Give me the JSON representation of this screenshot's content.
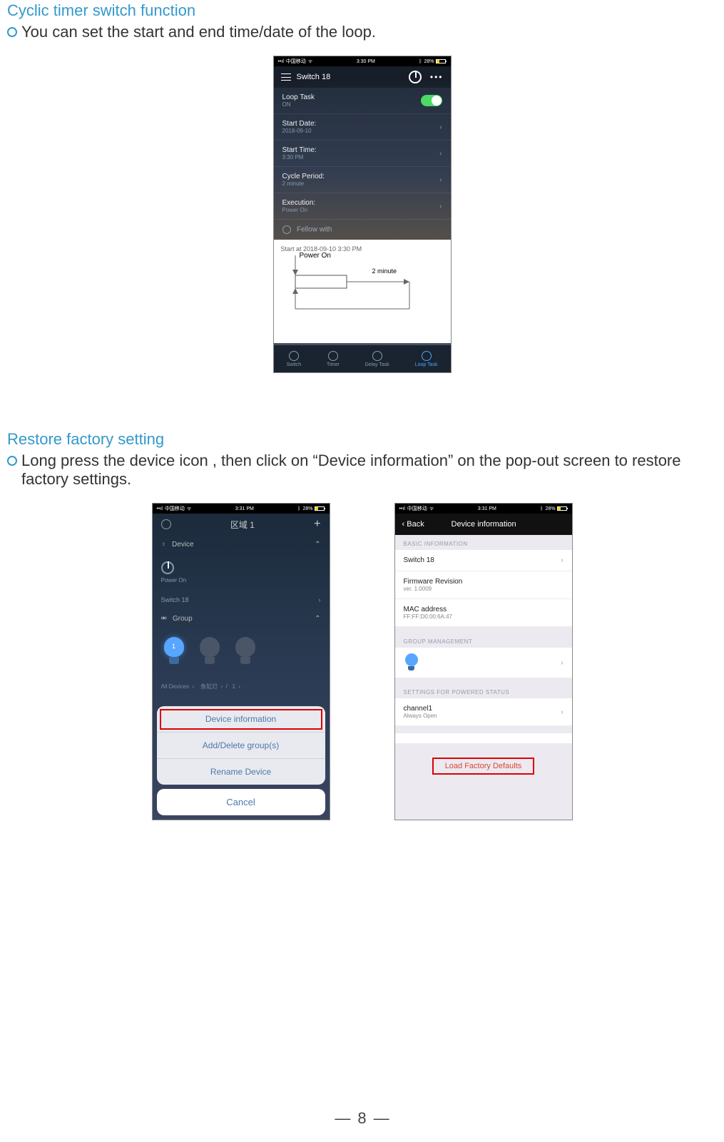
{
  "section1": {
    "heading": "Cyclic timer switch function",
    "text": "You can set the start and end time/date of the  loop."
  },
  "section2": {
    "heading": "Restore factory setting",
    "text": " Long press the device icon , then click on “Device information” on the pop-out screen to restore factory settings."
  },
  "phoneA": {
    "statusbar": {
      "carrier": "中国移动",
      "time": "3:30 PM",
      "battery": "28%"
    },
    "title": "Switch 18",
    "loopTask": {
      "label": "Loop Task",
      "state": "ON"
    },
    "startDate": {
      "label": "Start Date:",
      "value": "2018-09-10"
    },
    "startTime": {
      "label": "Start Time:",
      "value": "3:30 PM"
    },
    "cyclePeriod": {
      "label": "Cycle Period:",
      "value": "2 minute"
    },
    "execution": {
      "label": "Execution:",
      "value": "Power On"
    },
    "fellow": "Fellow with",
    "diagramStart": "Start at 2018-09-10 3:30 PM",
    "diagBox": "Power On",
    "diagPeriod": "2 minute",
    "tabs": {
      "switch": "Switch",
      "timer": "Timer",
      "delay": "Delay Task",
      "loop": "Loop Task"
    }
  },
  "phoneB": {
    "statusbar": {
      "carrier": "中国移动",
      "time": "3:31 PM",
      "battery": "28%"
    },
    "title": "区域 1",
    "device": "Device",
    "power": "Power On",
    "switch": "Switch 18",
    "group": "Group",
    "allDevices": "All Devices",
    "fishlight": "鱼缸灯",
    "one": "1",
    "sheet": {
      "item1": "Device information",
      "item2": "Add/Delete group(s)",
      "item3": "Rename Device",
      "cancel": "Cancel"
    }
  },
  "phoneC": {
    "statusbar": {
      "carrier": "中国移动",
      "time": "3:31 PM",
      "battery": "28%"
    },
    "back": "Back",
    "title": "Device information",
    "sect1": "BASIC INFORMATION",
    "row1": "Switch 18",
    "row2": {
      "label": "Firmware Revision",
      "value": "ver. 1.0009"
    },
    "row3": {
      "label": "MAC address",
      "value": "FF:FF:D0:00:6A:47"
    },
    "sect2": "GROUP MANAGEMENT",
    "sect3": "SETTINGS FOR POWERED STATUS",
    "row4": {
      "label": "channel1",
      "value": "Always Open"
    },
    "lfd": "Load Factory Defaults"
  },
  "pageNum": "8"
}
